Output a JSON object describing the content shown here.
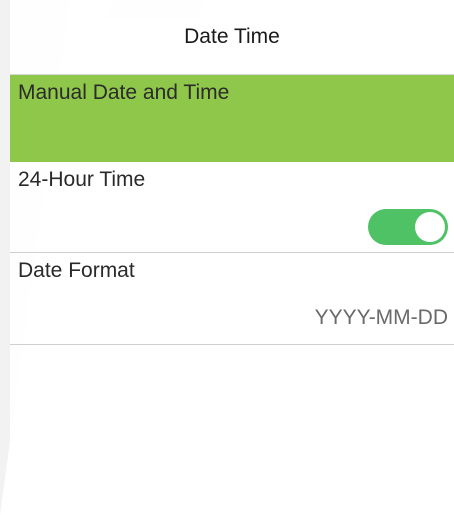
{
  "header": {
    "title": "Date Time"
  },
  "menu": {
    "items": [
      {
        "label": "Manual Date and Time"
      },
      {
        "label": "24-Hour Time",
        "toggle_on": true
      },
      {
        "label": "Date Format",
        "value": "YYYY-MM-DD"
      }
    ]
  },
  "colors": {
    "selected_row": "#8fc74a",
    "toggle_on": "#4fc266"
  }
}
